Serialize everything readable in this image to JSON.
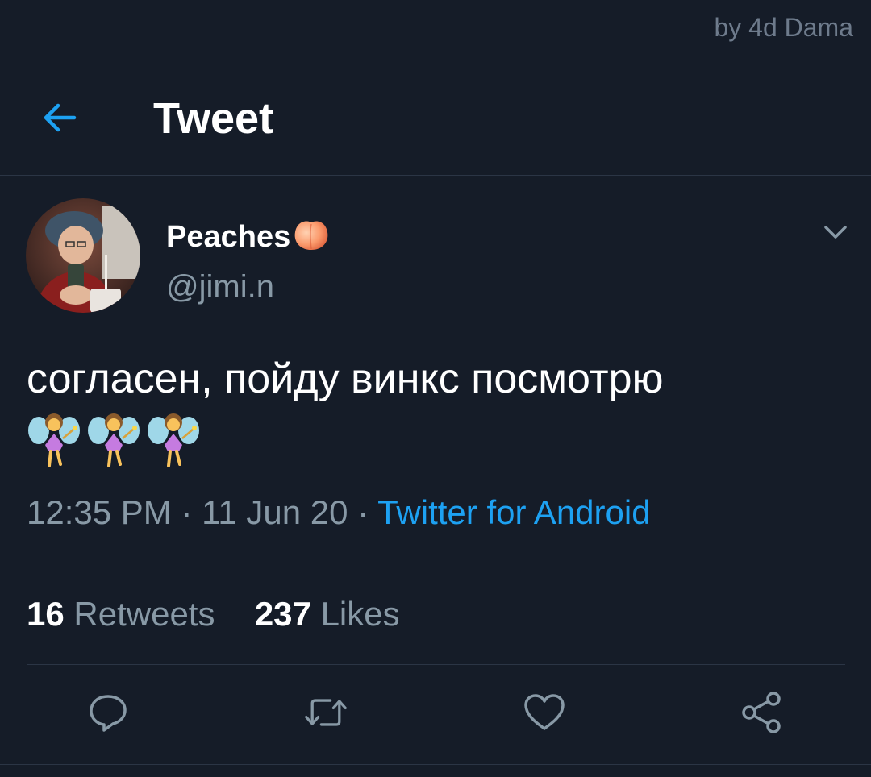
{
  "watermark": "by 4d Dama",
  "header": {
    "title": "Tweet",
    "back_icon": "arrow-left-icon"
  },
  "tweet": {
    "display_name": "Peaches",
    "name_emoji": "peach-emoji",
    "handle": "@jimi.n",
    "text": "согласен, пойду винкс посмотрю",
    "emojis": [
      "fairy-emoji",
      "fairy-emoji",
      "fairy-emoji"
    ],
    "time": "12:35 PM",
    "date": "11 Jun 20",
    "separator": "·",
    "source": "Twitter for Android",
    "retweets_count": "16",
    "retweets_label": "Retweets",
    "likes_count": "237",
    "likes_label": "Likes"
  },
  "actions": [
    "reply-icon",
    "retweet-icon",
    "like-icon",
    "share-icon"
  ],
  "colors": {
    "background": "#151c28",
    "accent": "#1da1f2",
    "muted": "#8899a6",
    "divider": "#2b3545"
  }
}
